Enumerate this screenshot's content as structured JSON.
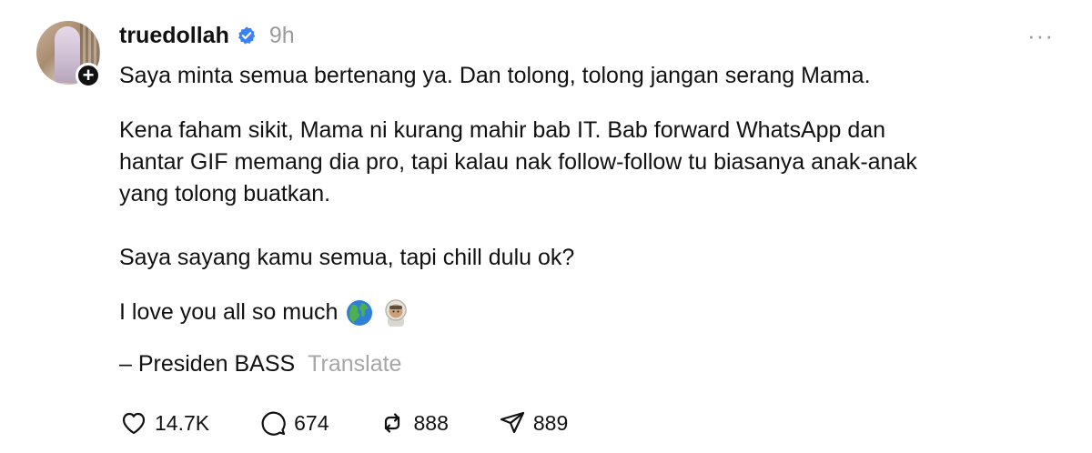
{
  "post": {
    "username": "truedollah",
    "time": "9h",
    "more": "···",
    "paragraphs": {
      "p1": "Saya minta semua bertenang ya. Dan tolong, tolong jangan serang Mama.",
      "p2_line1": "Kena faham sikit, Mama ni kurang mahir bab IT. Bab forward WhatsApp dan",
      "p2_line2": "hantar GIF memang dia pro, tapi kalau nak follow-follow tu biasanya anak-anak",
      "p2_line3": "yang tolong buatkan.",
      "p3": "Saya sayang kamu semua, tapi chill dulu ok?",
      "p4": "I love you all so much",
      "p5": "– Presiden BASS"
    },
    "translate_label": "Translate",
    "emojis": [
      "globe-americas",
      "astronaut"
    ],
    "actions": {
      "likes": "14.7K",
      "replies": "674",
      "reposts": "888",
      "shares": "889"
    },
    "colors": {
      "verified": "#3b82f6",
      "secondary_text": "#9a9a9a",
      "primary_text": "#111111"
    }
  }
}
